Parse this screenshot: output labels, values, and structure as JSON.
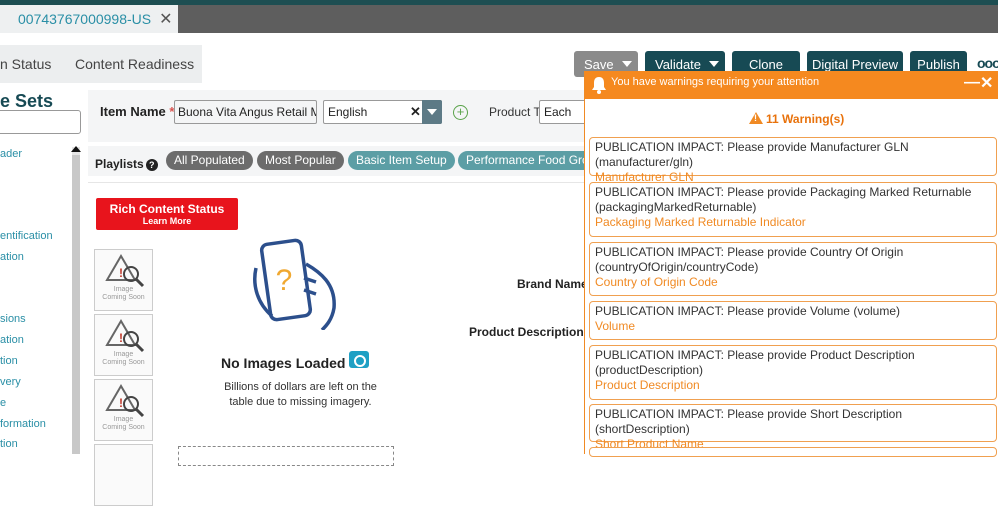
{
  "tab": {
    "title": "00743767000998-US"
  },
  "subnav": {
    "tab1": "n Status",
    "tab2": "Content Readiness"
  },
  "toolbar": {
    "save": "Save",
    "validate": "Validate",
    "clone": "Clone",
    "digital_preview": "Digital Preview",
    "publish": "Publish",
    "more": "ooo"
  },
  "sidebar": {
    "title": "e Sets",
    "items": [
      "ader",
      "entification",
      "ation",
      "sions",
      "ation",
      "tion",
      "very",
      "e",
      "formation",
      "tion"
    ]
  },
  "form": {
    "item_name_label": "Item Name",
    "required_mark": "*",
    "item_name_value": "Buona Vita Angus Retail Me",
    "language": "English",
    "product_type_label": "Product Type",
    "product_type_value": "Each"
  },
  "playlists": {
    "label": "Playlists",
    "items": [
      "All Populated",
      "Most Popular",
      "Basic Item Setup",
      "Performance Food Grou"
    ]
  },
  "rich_content": {
    "title": "Rich Content Status",
    "link": "Learn More"
  },
  "thumbnails": {
    "caption_1": "Image",
    "caption_2": "Coming Soon"
  },
  "no_images": {
    "title": "No Images Loaded",
    "desc": "Billions of dollars are left on the table due to missing imagery."
  },
  "fields": {
    "brand_name": "Brand Name",
    "product_description": "Product Description"
  },
  "warnings": {
    "header": "You have warnings requiring your attention",
    "count": "11 Warning(s)",
    "items": [
      {
        "msg": "PUBLICATION IMPACT: Please provide Manufacturer GLN (manufacturer/gln)",
        "field": "Manufacturer GLN"
      },
      {
        "msg": "PUBLICATION IMPACT: Please provide Packaging Marked Returnable (packagingMarkedReturnable)",
        "field": "Packaging Marked Returnable Indicator"
      },
      {
        "msg": "PUBLICATION IMPACT: Please provide Country Of Origin (countryOfOrigin/countryCode)",
        "field": "Country of Origin Code"
      },
      {
        "msg": "PUBLICATION IMPACT: Please provide Volume (volume)",
        "field": "Volume"
      },
      {
        "msg": "PUBLICATION IMPACT: Please provide Product Description (productDescription)",
        "field": "Product Description"
      },
      {
        "msg": "PUBLICATION IMPACT: Please provide Short Description (shortDescription)",
        "field": "Short Product Name"
      }
    ]
  },
  "colors": {
    "warning": "#f5891f",
    "primary": "#174a54",
    "accent": "#2a8fa6",
    "danger": "#e8141c"
  }
}
